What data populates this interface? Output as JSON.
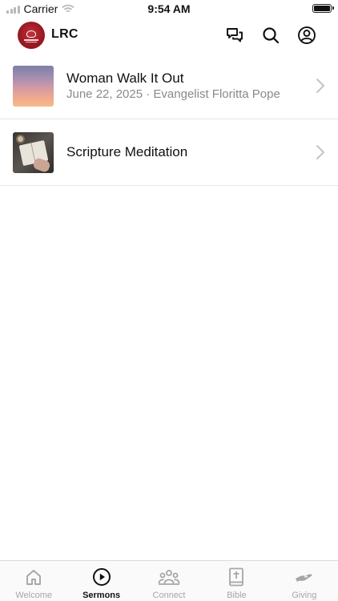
{
  "status_bar": {
    "carrier": "Carrier",
    "time": "9:54 AM",
    "icons": [
      "signal-icon",
      "wifi-icon",
      "battery-icon"
    ]
  },
  "header": {
    "title": "LRC",
    "logo_color": "#a11d27",
    "icons": [
      "chat-icon",
      "search-icon",
      "account-icon"
    ]
  },
  "sermons": [
    {
      "title": "Woman Walk It Out",
      "meta": "June 22, 2025 · Evangelist Floritta Pope",
      "thumbnail": "sunset-sky-image"
    },
    {
      "title": "Scripture Meditation",
      "meta": "",
      "thumbnail": "open-bible-image"
    }
  ],
  "tab_bar": {
    "active": "Sermons",
    "tabs": [
      {
        "label": "Welcome",
        "icon": "home-icon"
      },
      {
        "label": "Sermons",
        "icon": "play-circle-icon"
      },
      {
        "label": "Connect",
        "icon": "people-icon"
      },
      {
        "label": "Bible",
        "icon": "bible-icon"
      },
      {
        "label": "Giving",
        "icon": "giving-hand-icon"
      }
    ]
  },
  "colors": {
    "active_tab": "#111111",
    "inactive_tab": "#a6a6a6",
    "meta_text": "#8a8a8a",
    "divider": "#e6e6e6"
  }
}
